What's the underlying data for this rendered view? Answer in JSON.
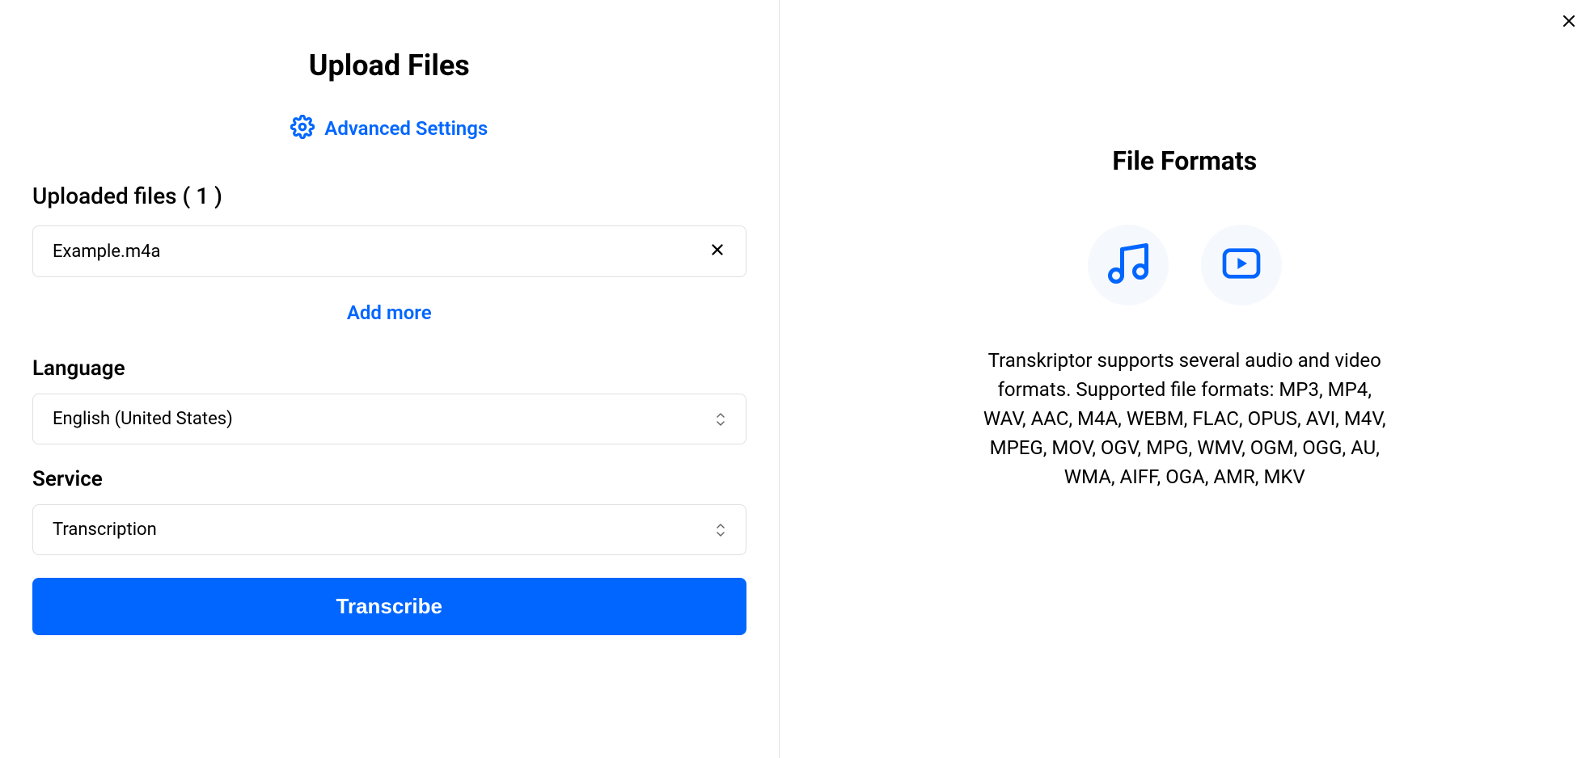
{
  "header": {
    "title": "Upload Files",
    "advanced_settings_label": "Advanced Settings"
  },
  "uploaded_files": {
    "label": "Uploaded files ( 1 )",
    "count": 1,
    "files": [
      {
        "name": "Example.m4a"
      }
    ],
    "add_more_label": "Add more"
  },
  "language": {
    "label": "Language",
    "value": "English (United States)"
  },
  "service": {
    "label": "Service",
    "value": "Transcription"
  },
  "actions": {
    "transcribe_label": "Transcribe"
  },
  "sidebar": {
    "title": "File Formats",
    "description": "Transkriptor supports several audio and video formats. Supported file formats: MP3, MP4, WAV, AAC, M4A, WEBM, FLAC, OPUS, AVI, M4V, MPEG, MOV, OGV, MPG, WMV, OGM, OGG, AU, WMA, AIFF, OGA, AMR, MKV"
  },
  "colors": {
    "primary": "#0066ff",
    "border": "#e0e0e0",
    "icon_bg": "#f5f8fc"
  }
}
